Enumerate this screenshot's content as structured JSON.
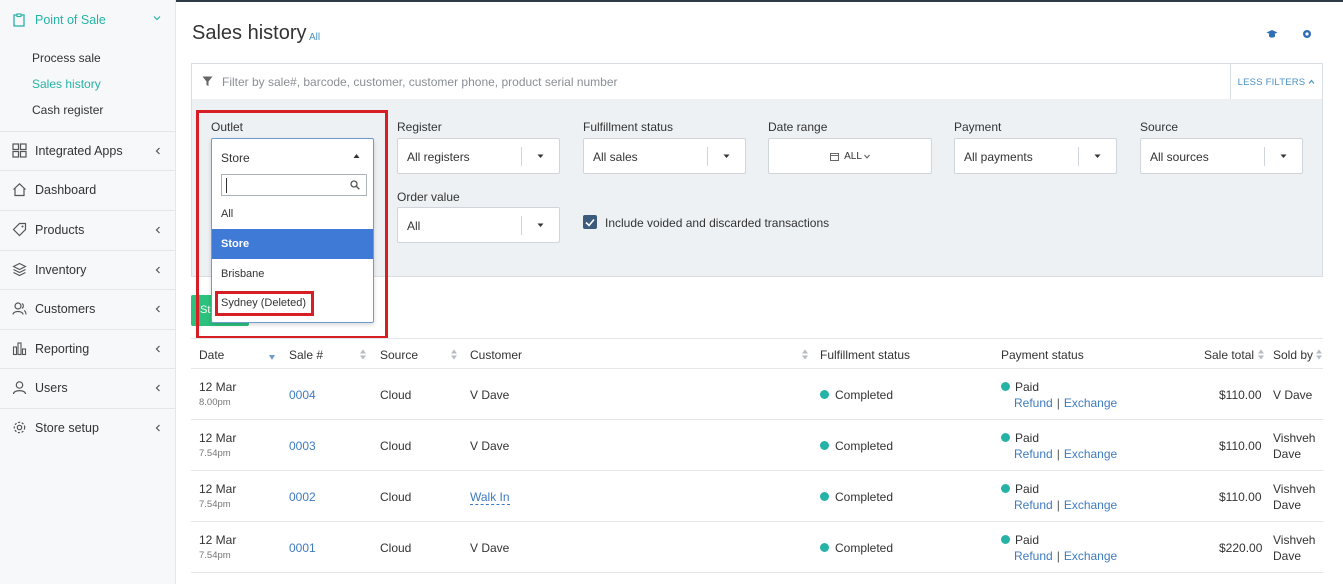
{
  "sidebar": {
    "section": "Point of Sale",
    "sub_items": [
      "Process sale",
      "Sales history",
      "Cash register"
    ],
    "items": [
      {
        "label": "Integrated Apps",
        "icon": "grid-icon"
      },
      {
        "label": "Dashboard",
        "icon": "home-icon"
      },
      {
        "label": "Products",
        "icon": "tag-icon"
      },
      {
        "label": "Inventory",
        "icon": "layers-icon"
      },
      {
        "label": "Customers",
        "icon": "customers-icon"
      },
      {
        "label": "Reporting",
        "icon": "bar-chart-icon"
      },
      {
        "label": "Users",
        "icon": "user-icon"
      },
      {
        "label": "Store setup",
        "icon": "gear-icon"
      }
    ]
  },
  "header": {
    "title": "Sales history",
    "subtitle": "All"
  },
  "search": {
    "placeholder": "Filter by sale#, barcode, customer, customer phone, product serial number",
    "less_filters": "LESS FILTERS"
  },
  "filters": {
    "outlet": {
      "label": "Outlet",
      "value": "Store"
    },
    "register": {
      "label": "Register",
      "value": "All registers"
    },
    "fulfillment": {
      "label": "Fulfillment status",
      "value": "All sales"
    },
    "date_range": {
      "label": "Date range",
      "value": "ALL"
    },
    "payment": {
      "label": "Payment",
      "value": "All payments"
    },
    "source": {
      "label": "Source",
      "value": "All sources"
    },
    "order_value": {
      "label": "Order value",
      "value": "All"
    },
    "include_voided": {
      "label": "Include voided and discarded transactions",
      "checked": true
    }
  },
  "outlet_dropdown": {
    "search_value": "",
    "options": [
      "All",
      "Store",
      "Brisbane",
      "Sydney (Deleted)"
    ],
    "selected": "Store"
  },
  "green_button_label": "St",
  "table": {
    "headers": [
      "Date",
      "Sale #",
      "Source",
      "Customer",
      "Fulfillment status",
      "Payment status",
      "Sale total",
      "Sold by"
    ],
    "rows": [
      {
        "date": "12 Mar",
        "time": "8.00pm",
        "sale": "0004",
        "source": "Cloud",
        "customer": "V Dave",
        "fulfillment": "Completed",
        "payment": "Paid",
        "refund": "Refund",
        "exchange": "Exchange",
        "total": "$110.00",
        "sold_by_1": "V Dave",
        "sold_by_2": ""
      },
      {
        "date": "12 Mar",
        "time": "7.54pm",
        "sale": "0003",
        "source": "Cloud",
        "customer": "V Dave",
        "fulfillment": "Completed",
        "payment": "Paid",
        "refund": "Refund",
        "exchange": "Exchange",
        "total": "$110.00",
        "sold_by_1": "Vishveh",
        "sold_by_2": "Dave"
      },
      {
        "date": "12 Mar",
        "time": "7.54pm",
        "sale": "0002",
        "source": "Cloud",
        "customer": "Walk In",
        "fulfillment": "Completed",
        "payment": "Paid",
        "refund": "Refund",
        "exchange": "Exchange",
        "total": "$110.00",
        "sold_by_1": "Vishveh",
        "sold_by_2": "Dave"
      },
      {
        "date": "12 Mar",
        "time": "7.54pm",
        "sale": "0001",
        "source": "Cloud",
        "customer": "V Dave",
        "fulfillment": "Completed",
        "payment": "Paid",
        "refund": "Refund",
        "exchange": "Exchange",
        "total": "$220.00",
        "sold_by_1": "Vishveh",
        "sold_by_2": "Dave"
      }
    ]
  },
  "colors": {
    "accent": "#26b3a7",
    "link": "#3f7bbf",
    "selected": "#3f7ad6",
    "highlight": "#d81e25",
    "button": "#2cc27d"
  }
}
